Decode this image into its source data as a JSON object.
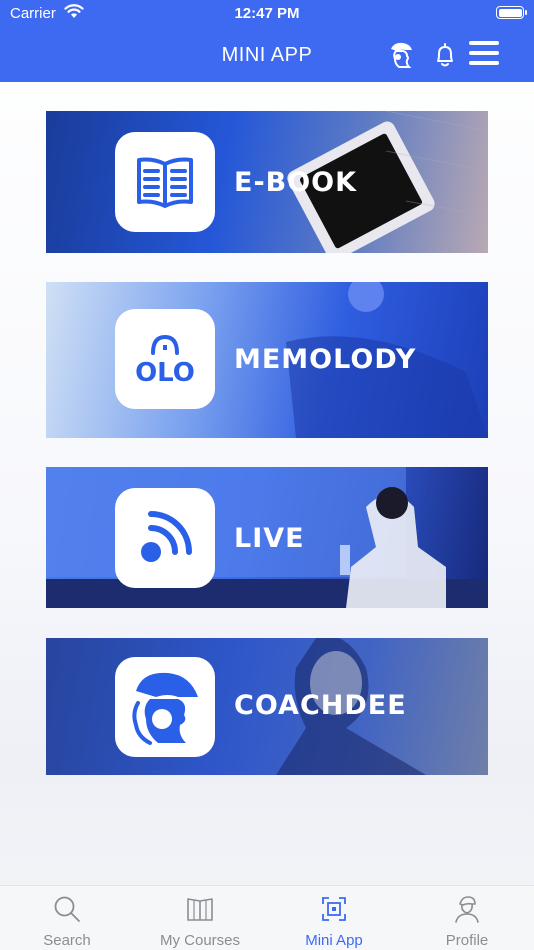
{
  "status_bar": {
    "carrier": "Carrier",
    "time": "12:47 PM"
  },
  "nav": {
    "title": "MINI APP",
    "icons": [
      "coachdee-head-icon",
      "bell-icon",
      "hamburger-menu-icon"
    ]
  },
  "cards": [
    {
      "label": "E-BOOK",
      "icon": "open-book-icon"
    },
    {
      "label": "MEMOLODY",
      "icon": "olo-logo-icon"
    },
    {
      "label": "LIVE",
      "icon": "rss-feed-icon"
    },
    {
      "label": "COACHDEE",
      "icon": "coach-head-icon"
    }
  ],
  "tabbar": {
    "items": [
      {
        "label": "Search",
        "icon": "search-icon",
        "active": false
      },
      {
        "label": "My Courses",
        "icon": "book-icon",
        "active": false
      },
      {
        "label": "Mini App",
        "icon": "mini-app-icon",
        "active": true
      },
      {
        "label": "Profile",
        "icon": "profile-icon",
        "active": false
      }
    ]
  },
  "colors": {
    "primary": "#3e6af2",
    "tab_inactive": "#8a8d93",
    "icon_blue": "#2a5fe8"
  }
}
